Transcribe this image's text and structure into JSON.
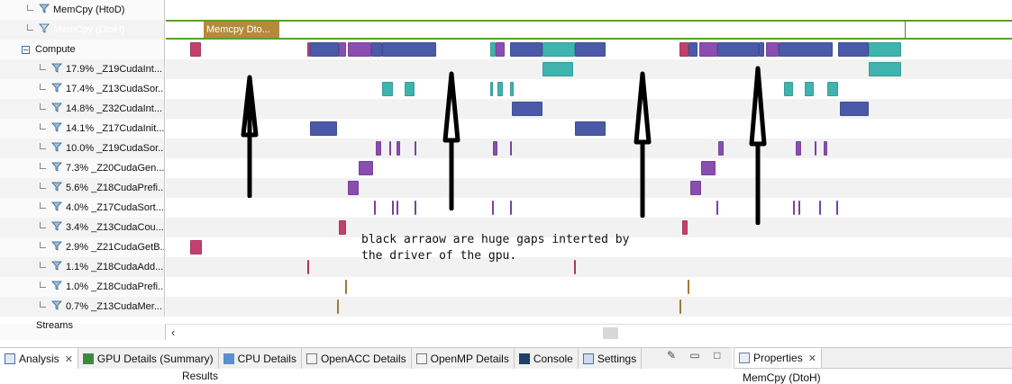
{
  "timeline": {
    "rows": [
      {
        "label": "MemCpy (HtoD)",
        "kind": "child",
        "indent": 1
      },
      {
        "label": "MemCpy (DtoH)",
        "kind": "child",
        "indent": 1,
        "selected": true
      },
      {
        "label": "Compute",
        "kind": "group"
      },
      {
        "label": "17.9% _Z19CudaInt...",
        "kind": "child",
        "indent": 2
      },
      {
        "label": "17.4% _Z13CudaSor...",
        "kind": "child",
        "indent": 2
      },
      {
        "label": "14.8% _Z32CudaInt...",
        "kind": "child",
        "indent": 2
      },
      {
        "label": "14.1% _Z17CudaInit...",
        "kind": "child",
        "indent": 2
      },
      {
        "label": "10.0% _Z19CudaSor...",
        "kind": "child",
        "indent": 2
      },
      {
        "label": "7.3% _Z20CudaGen...",
        "kind": "child",
        "indent": 2
      },
      {
        "label": "5.6% _Z18CudaPrefi...",
        "kind": "child",
        "indent": 2
      },
      {
        "label": "4.0% _Z17CudaSort...",
        "kind": "child",
        "indent": 2
      },
      {
        "label": "3.4% _Z13CudaCou...",
        "kind": "child",
        "indent": 2
      },
      {
        "label": "2.9% _Z21CudaGetB...",
        "kind": "child",
        "indent": 2
      },
      {
        "label": "1.1% _Z18CudaAdd...",
        "kind": "child",
        "indent": 2
      },
      {
        "label": "1.0% _Z18CudaPrefi...",
        "kind": "child",
        "indent": 2
      },
      {
        "label": "0.7% _Z13CudaMer...",
        "kind": "child",
        "indent": 2
      }
    ],
    "memcpy_block_label": "Memcpy Dto...",
    "cut_off_label": "Streams"
  },
  "annotation": {
    "line1": "black arraow are huge gaps interted by",
    "line2": "the driver of the gpu."
  },
  "colors": {
    "selected_row": "#4f9a2a",
    "memcpy": "#b48a3c",
    "blue_kernel": "#4a5aa8",
    "teal_kernel": "#3fb3ad",
    "purple_kernel": "#8a4db0",
    "pink_kernel": "#c04070"
  },
  "bottom_tabs": [
    {
      "label": "Analysis",
      "icon": "analysis-icon",
      "active": true,
      "closable": true
    },
    {
      "label": "GPU Details (Summary)",
      "icon": "gpu-details-icon"
    },
    {
      "label": "CPU Details",
      "icon": "cpu-details-icon"
    },
    {
      "label": "OpenACC Details",
      "icon": "openacc-icon"
    },
    {
      "label": "OpenMP Details",
      "icon": "openmp-icon"
    },
    {
      "label": "Console",
      "icon": "console-icon"
    },
    {
      "label": "Settings",
      "icon": "settings-icon"
    }
  ],
  "properties_tab": {
    "label": "Properties",
    "closable": true
  },
  "bottom": {
    "results_label": "Results",
    "properties_value": "MemCpy (DtoH)"
  }
}
